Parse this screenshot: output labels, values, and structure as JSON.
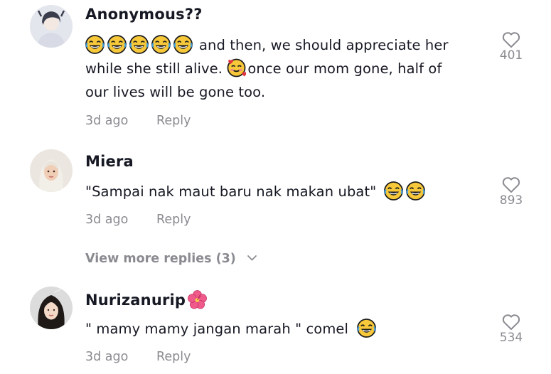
{
  "comments": [
    {
      "username": "Anonymous??",
      "text_line1": "and then, we should appreciate her",
      "text_line2a": "while she still alive.",
      "text_line2b": "once our mom gone, half of",
      "text_line3": "our lives will be gone too.",
      "time": "3d ago",
      "reply_label": "Reply",
      "likes": "401",
      "emojis": [
        "face-with-tears-of-joy",
        "smiling-face-with-hearts"
      ]
    },
    {
      "username": "Miera",
      "text": "\"Sampai nak maut baru nak makan ubat\"",
      "time": "3d ago",
      "reply_label": "Reply",
      "likes": "893",
      "emojis": [
        "face-with-tears-of-joy"
      ]
    },
    {
      "username": "Nurizanurip",
      "text": "\" mamy mamy jangan marah \" comel",
      "time": "3d ago",
      "reply_label": "Reply",
      "likes": "534",
      "emojis": [
        "hibiscus",
        "face-with-tears-of-joy"
      ]
    }
  ],
  "view_more_label": "View more replies (3)",
  "icons": {
    "like": "heart-outline-icon",
    "expand": "chevron-down-icon"
  },
  "colors": {
    "text": "#161823",
    "muted": "#8a8b91",
    "emoji_face": "#f7c83a"
  }
}
